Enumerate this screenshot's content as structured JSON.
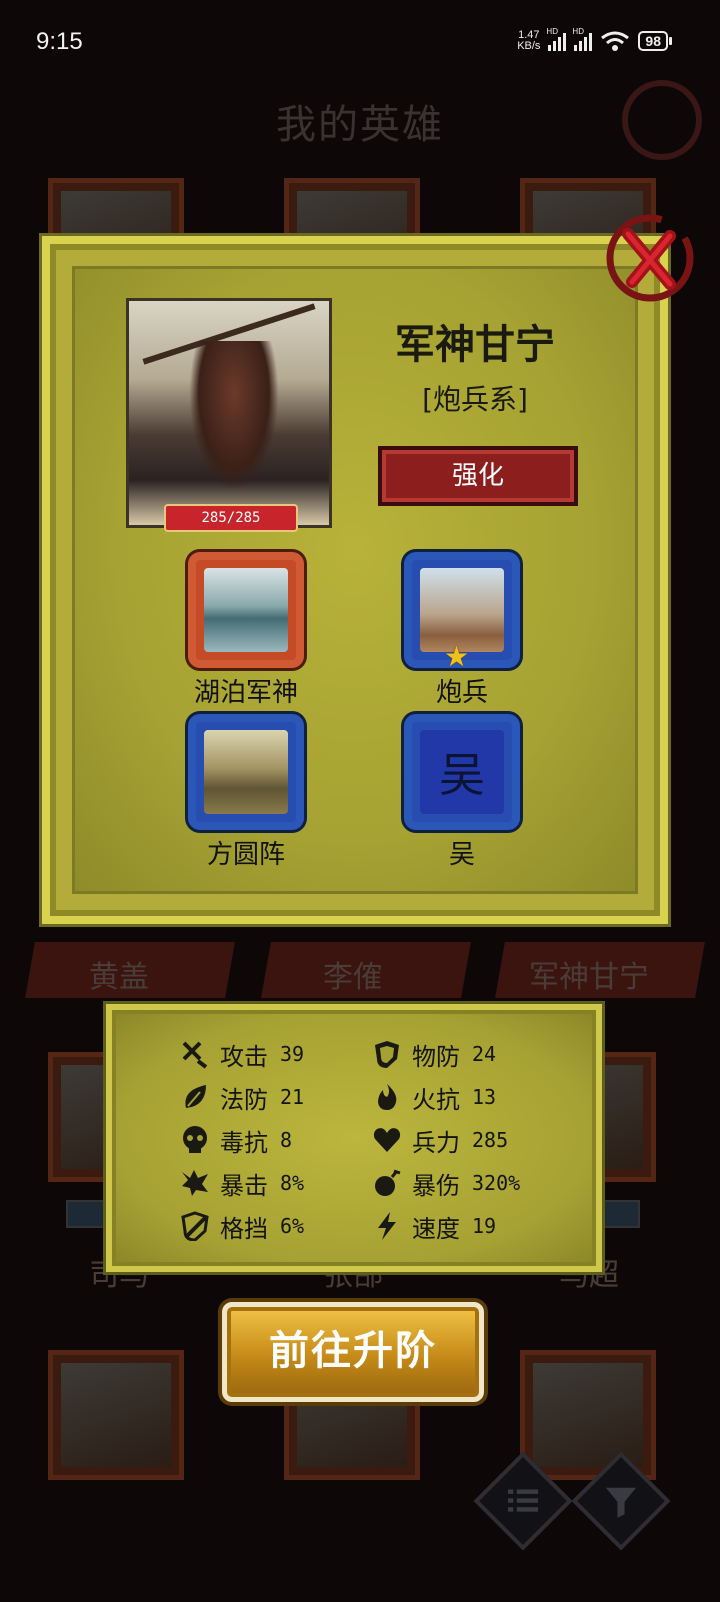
{
  "status_bar": {
    "time": "9:15",
    "net_speed_value": "1.47",
    "net_speed_unit": "KB/s",
    "sig1_label": "HD",
    "sig2_label": "HD",
    "battery": "98"
  },
  "background": {
    "title": "我的英雄",
    "hero_names_row1": [
      "黄盖",
      "李傕",
      "军神甘宁"
    ],
    "hero_names_row2": [
      "司马",
      "张郃",
      "马超"
    ]
  },
  "hero": {
    "name": "军神甘宁",
    "type": "[炮兵系]",
    "hp": "285/285",
    "strengthen_label": "强化"
  },
  "skills": [
    {
      "label": "湖泊军神",
      "frame": "orange"
    },
    {
      "label": "炮兵",
      "frame": "blue"
    },
    {
      "label": "方圆阵",
      "frame": "blue"
    },
    {
      "label": "吴",
      "frame": "blue",
      "glyph": "吴"
    }
  ],
  "stats": [
    {
      "icon": "sword-icon",
      "label": "攻击",
      "value": "39"
    },
    {
      "icon": "shield-icon",
      "label": "物防",
      "value": "24"
    },
    {
      "icon": "leaf-icon",
      "label": "法防",
      "value": "21"
    },
    {
      "icon": "fire-icon",
      "label": "火抗",
      "value": "13"
    },
    {
      "icon": "skull-icon",
      "label": "毒抗",
      "value": "8"
    },
    {
      "icon": "heart-icon",
      "label": "兵力",
      "value": "285"
    },
    {
      "icon": "crit-icon",
      "label": "暴击",
      "value": "8%"
    },
    {
      "icon": "bomb-icon",
      "label": "暴伤",
      "value": "320%"
    },
    {
      "icon": "block-icon",
      "label": "格挡",
      "value": "6%"
    },
    {
      "icon": "lightning-icon",
      "label": "速度",
      "value": "19"
    }
  ],
  "advance_label": "前往升阶",
  "colors": {
    "dialog_bg": "#b3ac3a",
    "dialog_border": "#d9d24e",
    "strengthen_bg": "#8c1e1e",
    "advance_gold": "#e0a52a",
    "skill_blue": "#2a57b8",
    "skill_orange": "#d05a33"
  }
}
